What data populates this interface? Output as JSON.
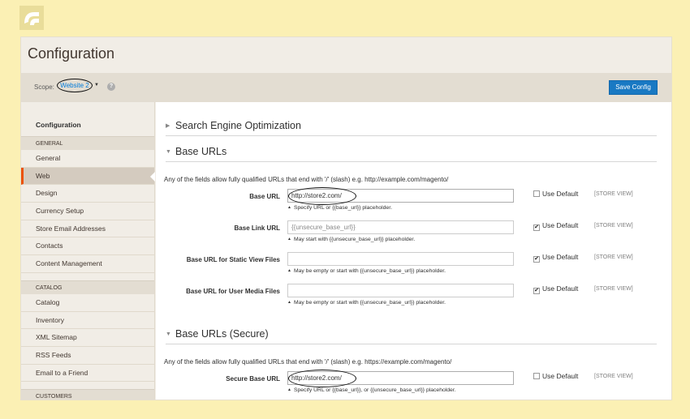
{
  "page": {
    "title": "Configuration"
  },
  "scope": {
    "label": "Scope:",
    "value": "Website 2",
    "help": "?"
  },
  "actions": {
    "save_label": "Save Config"
  },
  "sidebar": {
    "title": "Configuration",
    "groups": [
      {
        "label": "GENERAL",
        "items": [
          "General",
          "Web",
          "Design",
          "Currency Setup",
          "Store Email Addresses",
          "Contacts",
          "Content Management"
        ]
      },
      {
        "label": "CATALOG",
        "items": [
          "Catalog",
          "Inventory",
          "XML Sitemap",
          "RSS Feeds",
          "Email to a Friend"
        ]
      },
      {
        "label": "CUSTOMERS",
        "items": []
      }
    ],
    "active": "Web"
  },
  "sections": {
    "seo": "Search Engine Optimization",
    "base_urls": "Base URLs",
    "base_urls_note": "Any of the fields allow fully qualified URLs that end with '/' (slash) e.g. http://example.com/magento/",
    "secure": "Base URLs (Secure)",
    "secure_note": "Any of the fields allow fully qualified URLs that end with '/' (slash) e.g. https://example.com/magento/"
  },
  "fields": [
    {
      "label": "Base URL",
      "value": "http://store2.com/",
      "hint": "Specify URL or {{base_url}} placeholder.",
      "use_default": false
    },
    {
      "label": "Base Link URL",
      "value": "{{unsecure_base_url}}",
      "hint": "May start with {{unsecure_base_url}} placeholder.",
      "use_default": true
    },
    {
      "label": "Base URL for Static View Files",
      "value": "",
      "hint": "May be empty or start with {{unsecure_base_url}} placeholder.",
      "use_default": true
    },
    {
      "label": "Base URL for User Media Files",
      "value": "",
      "hint": "May be empty or start with {{unsecure_base_url}} placeholder.",
      "use_default": true
    },
    {
      "label": "Secure Base URL",
      "value": "http://store2.com/",
      "hint": "Specify URL or {{base_url}}, or {{unsecure_base_url}} placeholder.",
      "use_default": false
    }
  ],
  "labels": {
    "use_default": "Use Default",
    "store_view": "[STORE VIEW]"
  },
  "colors": {
    "accent": "#eb5202",
    "button": "#1979c3",
    "background": "#fbf0b4"
  }
}
